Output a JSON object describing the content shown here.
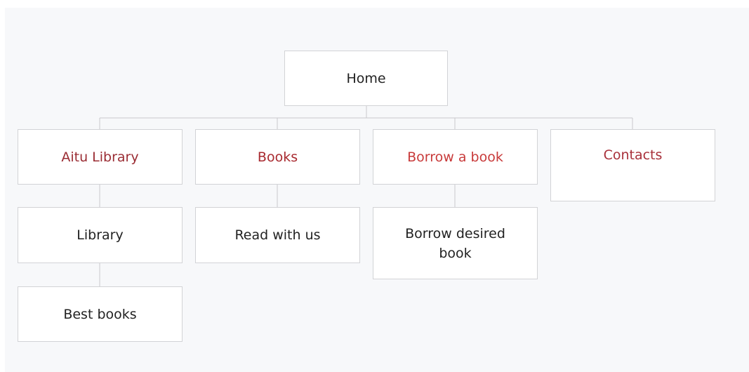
{
  "sitemap": {
    "home": {
      "label": "Home",
      "color": "#222222"
    },
    "sections": [
      {
        "label": "Aitu Library",
        "color": "#9a2c33"
      },
      {
        "label": "Books",
        "color": "#a8292f"
      },
      {
        "label": "Borrow a book",
        "color": "#c83a3a"
      },
      {
        "label": "Contacts",
        "color": "#a8303a"
      }
    ],
    "subpages": [
      {
        "label": "Library",
        "parent": "Aitu Library"
      },
      {
        "label": "Best books",
        "parent": "Library"
      },
      {
        "label": "Read with us",
        "parent": "Books"
      },
      {
        "label": "Borrow desired book",
        "parent": "Borrow a book"
      }
    ]
  }
}
